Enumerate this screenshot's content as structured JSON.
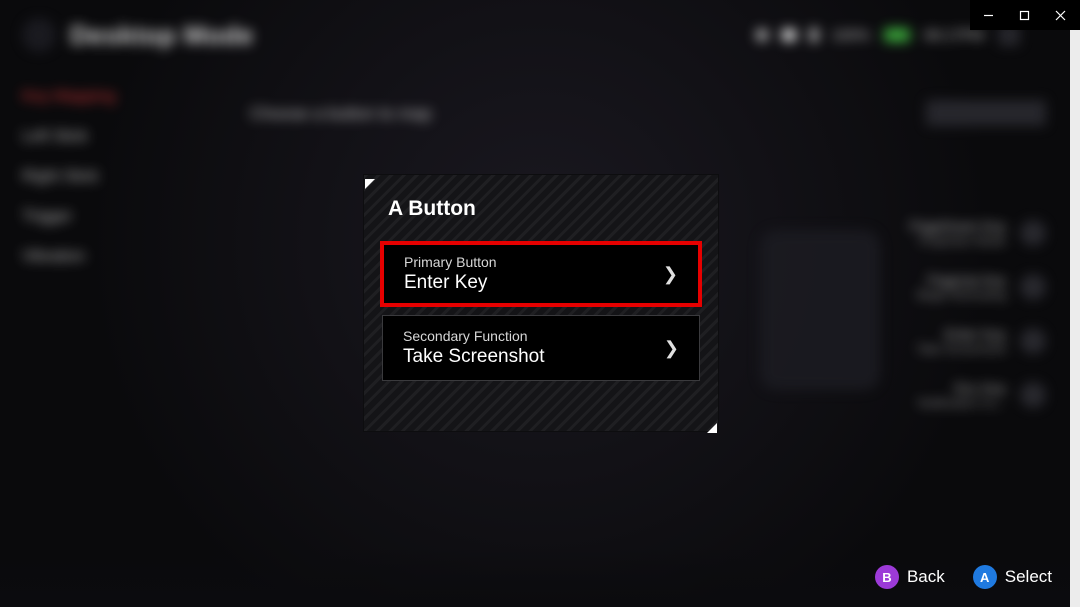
{
  "header": {
    "title": "Desktop Mode",
    "battery_pct": "100%",
    "time": "06:17PM"
  },
  "sidebar": {
    "items": [
      {
        "label": "Key Mapping"
      },
      {
        "label": "Left Stick"
      },
      {
        "label": "Right Stick"
      },
      {
        "label": "Trigger"
      },
      {
        "label": "Vibration"
      }
    ]
  },
  "prompt": "Choose a button to map",
  "reset_label": "Reset to Default",
  "right_hints": [
    {
      "top": "PageDown Key",
      "bottom": "Projection Mode"
    },
    {
      "top": "PageUp Key",
      "bottom": "Begin Recording"
    },
    {
      "top": "Enter Key",
      "bottom": "Take Screenshot"
    },
    {
      "top": "Esc Key",
      "bottom": "Notification Ce..."
    }
  ],
  "modal": {
    "title": "A Button",
    "primary": {
      "label": "Primary Button",
      "value": "Enter Key"
    },
    "secondary": {
      "label": "Secondary Function",
      "value": "Take Screenshot"
    }
  },
  "legend": {
    "back": {
      "glyph": "B",
      "text": "Back"
    },
    "select": {
      "glyph": "A",
      "text": "Select"
    }
  }
}
